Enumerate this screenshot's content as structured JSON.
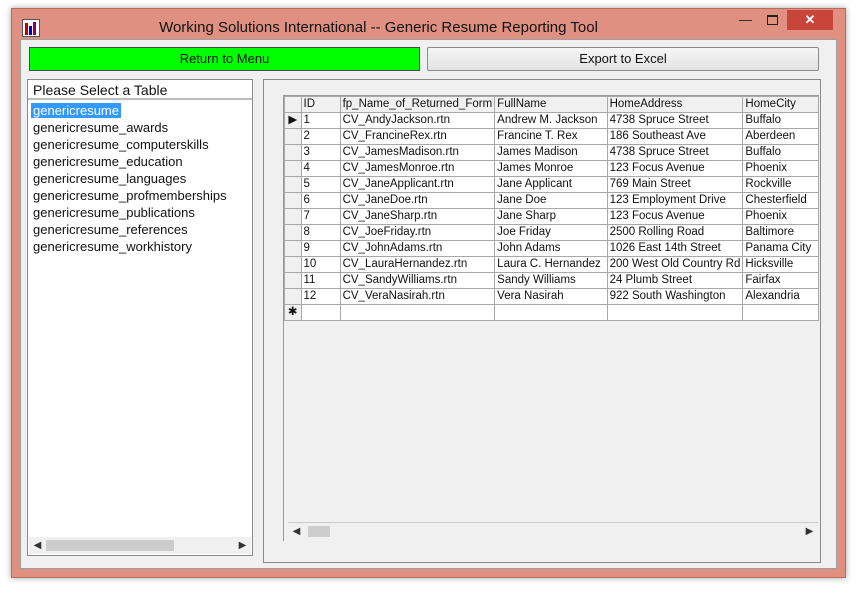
{
  "window": {
    "title": "Working Solutions International  --  Generic Resume Reporting Tool",
    "minimize_glyph": "—",
    "close_glyph": "✕"
  },
  "toolbar": {
    "return_label": "Return to Menu",
    "export_label": "Export to Excel"
  },
  "table_list": {
    "header": "Please Select a Table",
    "selected_index": 0,
    "items": [
      "genericresume",
      "genericresume_awards",
      "genericresume_computerskills",
      "genericresume_education",
      "genericresume_languages",
      "genericresume_profmemberships",
      "genericresume_publications",
      "genericresume_references",
      "genericresume_workhistory"
    ]
  },
  "grid": {
    "columns": [
      "ID",
      "fp_Name_of_Returned_Form",
      "FullName",
      "HomeAddress",
      "HomeCity"
    ],
    "rows": [
      [
        "1",
        "CV_AndyJackson.rtn",
        "Andrew M. Jackson",
        "4738 Spruce Street",
        "Buffalo"
      ],
      [
        "2",
        "CV_FrancineRex.rtn",
        "Francine T. Rex",
        "186 Southeast Ave",
        "Aberdeen"
      ],
      [
        "3",
        "CV_JamesMadison.rtn",
        "James Madison",
        "4738 Spruce Street",
        "Buffalo"
      ],
      [
        "4",
        "CV_JamesMonroe.rtn",
        "James Monroe",
        "123 Focus Avenue",
        "Phoenix"
      ],
      [
        "5",
        "CV_JaneApplicant.rtn",
        "Jane Applicant",
        "769 Main Street",
        "Rockville"
      ],
      [
        "6",
        "CV_JaneDoe.rtn",
        "Jane Doe",
        "123 Employment Drive",
        "Chesterfield"
      ],
      [
        "7",
        "CV_JaneSharp.rtn",
        "Jane Sharp",
        "123 Focus Avenue",
        "Phoenix"
      ],
      [
        "8",
        "CV_JoeFriday.rtn",
        "Joe Friday",
        "2500 Rolling Road",
        "Baltimore"
      ],
      [
        "9",
        "CV_JohnAdams.rtn",
        "John Adams",
        "1026 East 14th Street",
        "Panama City"
      ],
      [
        "10",
        "CV_LauraHernandez.rtn",
        "Laura C. Hernandez",
        "200 West Old Country Rd",
        "Hicksville"
      ],
      [
        "11",
        "CV_SandyWilliams.rtn",
        "Sandy Williams",
        "24 Plumb Street",
        "Fairfax"
      ],
      [
        "12",
        "CV_VeraNasirah.rtn",
        "Vera Nasirah",
        "922 South Washington",
        "Alexandria"
      ]
    ],
    "current_row_marker": "▶",
    "new_row_marker": "✱"
  },
  "colors": {
    "window_frame": "#e09080",
    "return_button": "#00ff00",
    "selection": "#3399ff",
    "close_button": "#c7453a"
  },
  "icons": {
    "app": "bar-chart-app-icon",
    "scroll_left": "◀",
    "scroll_right": "▶"
  }
}
